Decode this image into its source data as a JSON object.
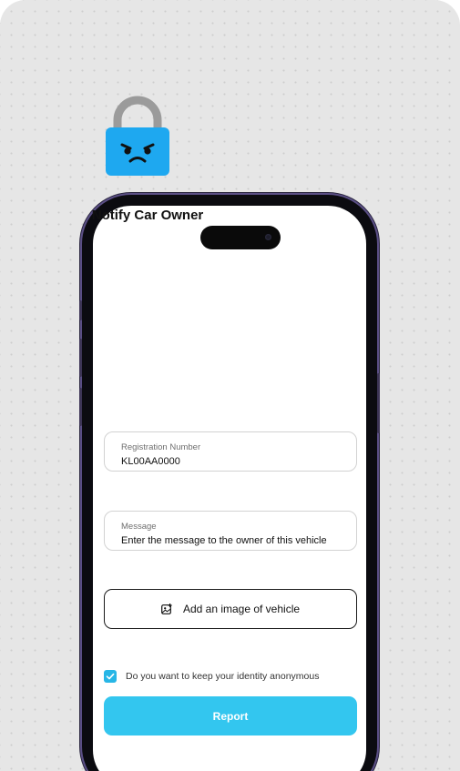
{
  "title": "Notify Car Owner",
  "lock_illustration": "angry-lock-icon",
  "registration": {
    "label": "Registration Number",
    "value": "KL00AA0000"
  },
  "message": {
    "label": "Message",
    "placeholder": "Enter the message to the owner of this vehicle"
  },
  "add_image": {
    "label": "Add an image of vehicle",
    "icon": "add-image-icon"
  },
  "anonymous": {
    "label": "Do you want to keep your identity anonymous",
    "checked": true
  },
  "report_button": {
    "label": "Report"
  },
  "colors": {
    "accent": "#33c6ef",
    "lock_body": "#1ea8f0",
    "lock_shackle": "#9b9b9b",
    "phone_frame": "#5b4f86"
  }
}
